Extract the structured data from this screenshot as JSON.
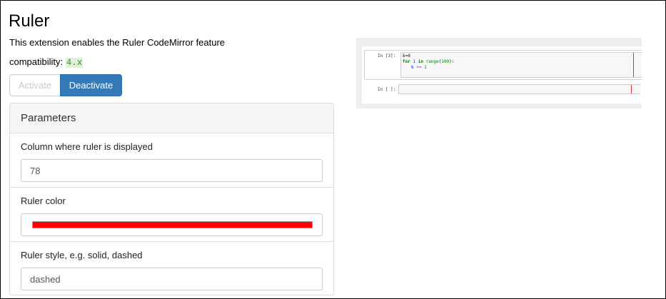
{
  "extension": {
    "title": "Ruler",
    "description": "This extension enables the Ruler CodeMirror feature",
    "compatibility_label": "compatibility:",
    "compatibility_version": "4.x"
  },
  "buttons": {
    "activate_label": "Activate",
    "deactivate_label": "Deactivate"
  },
  "parameters": {
    "heading": "Parameters",
    "items": [
      {
        "label": "Column where ruler is displayed",
        "value": "78"
      },
      {
        "label": "Ruler color",
        "value": "#ff0000"
      },
      {
        "label": "Ruler style, e.g. solid, dashed",
        "value": "dashed"
      }
    ]
  },
  "preview": {
    "cell1_prompt": "In [3]:",
    "cell1_code_line1": "k=0",
    "cell1_code_line2_kw1": "for",
    "cell1_code_line2_var": "i",
    "cell1_code_line2_kw2": "in",
    "cell1_code_line2_fn": "range",
    "cell1_code_line2_arg": "100",
    "cell1_code_line3_var": "k",
    "cell1_code_line3_op": "+=",
    "cell1_code_line3_val": "1",
    "cell2_prompt": "In [ ]:"
  },
  "colors": {
    "ruler": "#ff0000",
    "accent": "#337ab7"
  }
}
